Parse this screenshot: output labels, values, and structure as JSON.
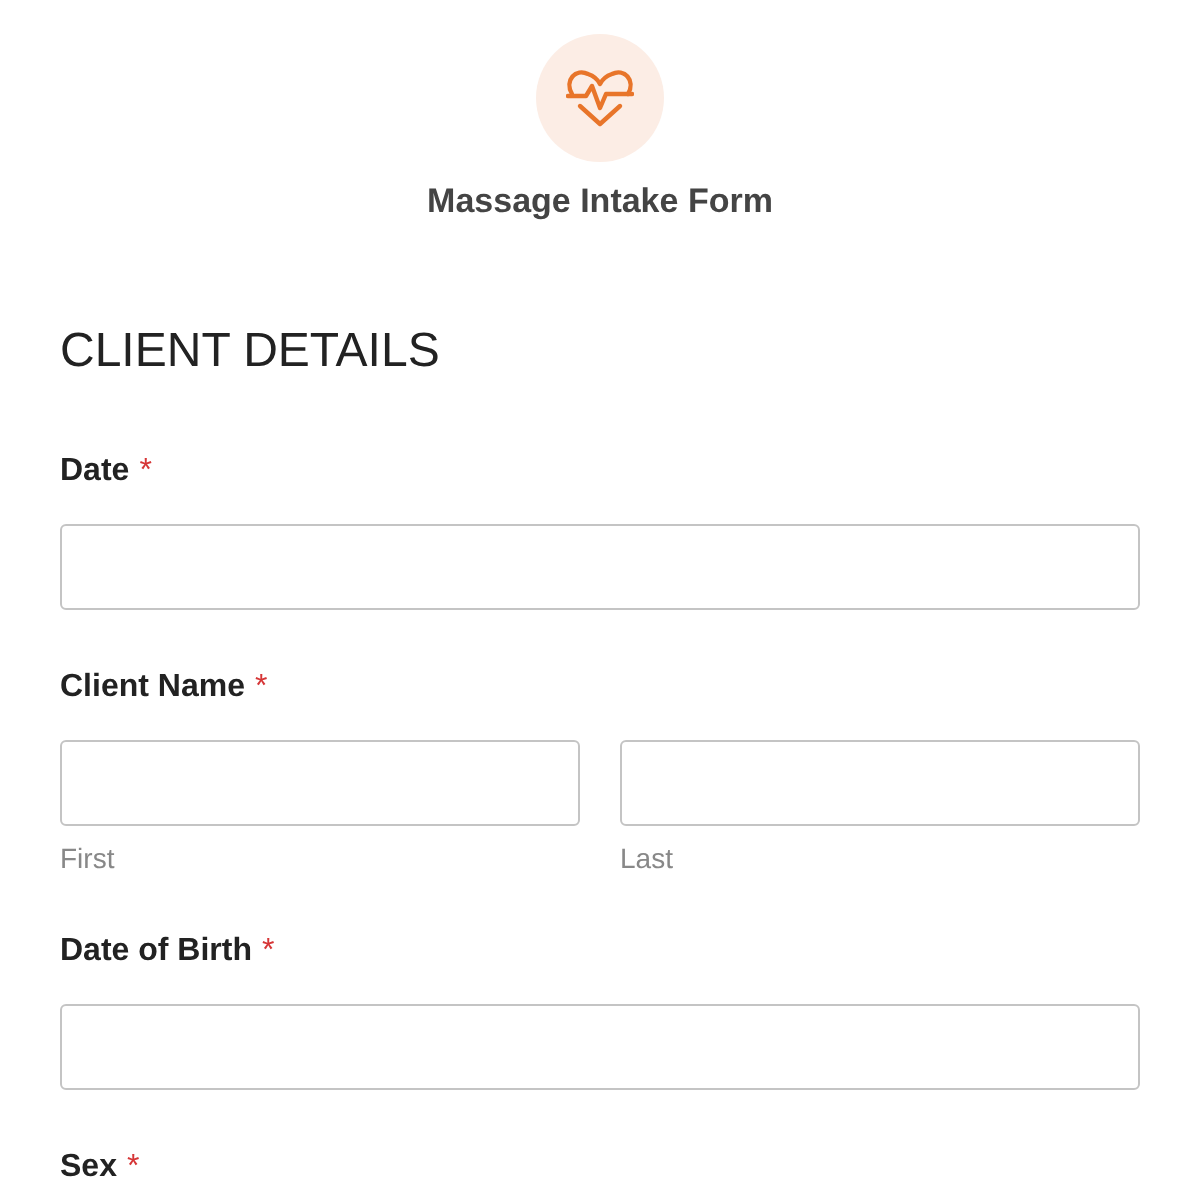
{
  "form": {
    "title": "Massage Intake Form"
  },
  "section": {
    "heading": "CLIENT DETAILS"
  },
  "fields": [
    {
      "kind": "text",
      "label": "Date",
      "required_mark": "*"
    },
    {
      "kind": "name",
      "label": "Client Name",
      "required_mark": "*",
      "sublabels": [
        "First",
        "Last"
      ]
    },
    {
      "kind": "text",
      "label": "Date of Birth",
      "required_mark": "*"
    },
    {
      "kind": "label",
      "label": "Sex",
      "required_mark": "*"
    }
  ]
}
